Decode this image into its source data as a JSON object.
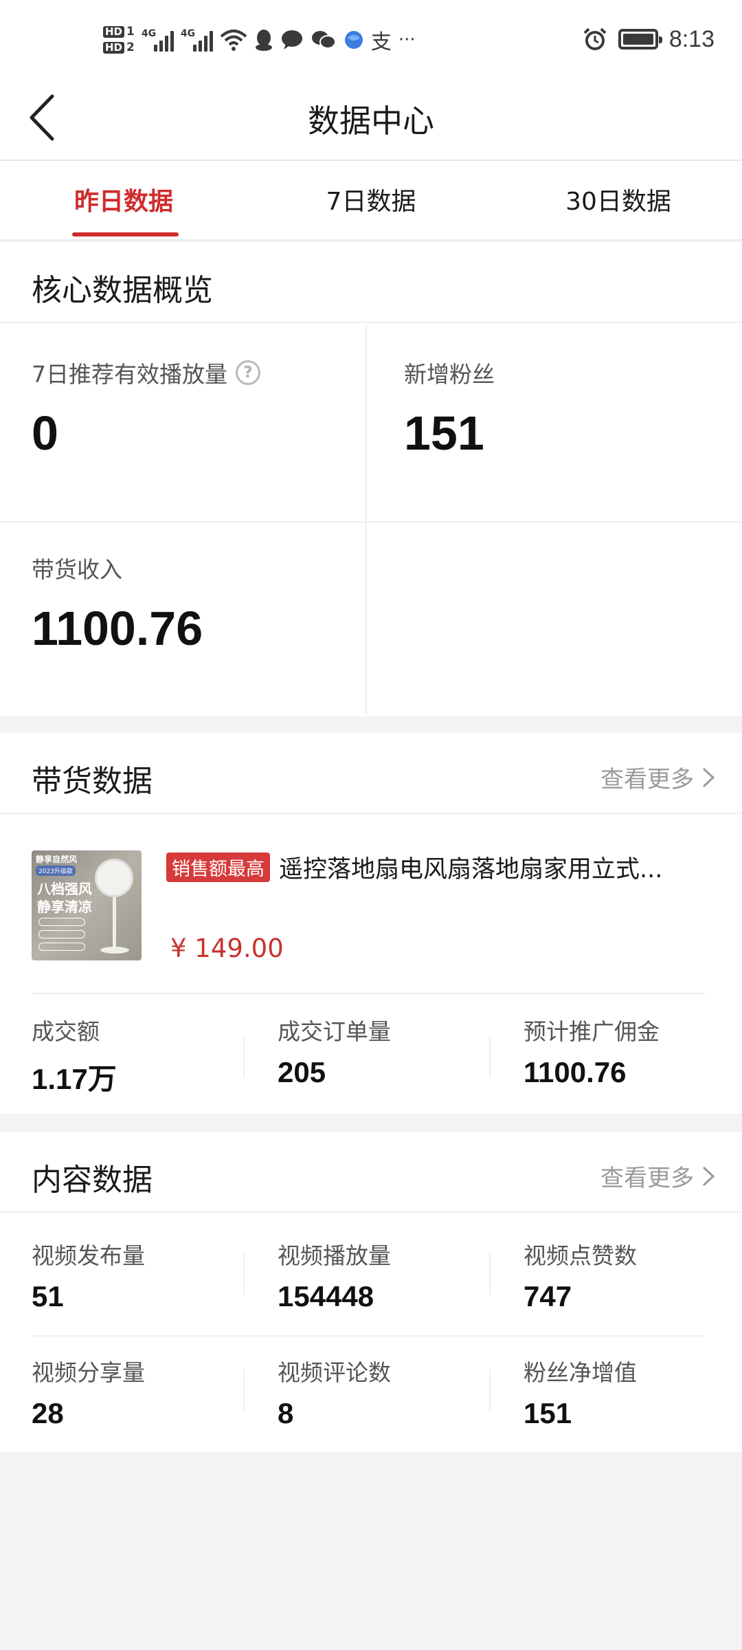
{
  "status_bar": {
    "time": "8:13",
    "sim1": "HD",
    "sim1_num": "1",
    "sim2": "HD",
    "sim2_num": "2",
    "net1": "4G",
    "net2": "4G",
    "alipay": "支",
    "more": "···",
    "icons": [
      "sim-hd-icon",
      "signal-icon",
      "wifi-icon",
      "qq-icon",
      "message-icon",
      "wechat-icon",
      "browser-icon",
      "alipay-icon",
      "alarm-icon",
      "battery-icon"
    ]
  },
  "header": {
    "title": "数据中心"
  },
  "tabs": [
    {
      "label": "昨日数据",
      "active": true
    },
    {
      "label": "7日数据",
      "active": false
    },
    {
      "label": "30日数据",
      "active": false
    }
  ],
  "core": {
    "title": "核心数据概览",
    "items": [
      {
        "label": "7日推荐有效播放量",
        "value": "0",
        "help": "?"
      },
      {
        "label": "新增粉丝",
        "value": "151"
      },
      {
        "label": "带货收入",
        "value": "1100.76"
      }
    ]
  },
  "sales": {
    "title": "带货数据",
    "more": "查看更多",
    "product": {
      "badge": "销售额最高",
      "name": "遥控落地扇电风扇落地扇家用立式...",
      "price": "¥ 149.00",
      "img_brand": "静享自然风",
      "img_tag": "2023升级款",
      "img_line1": "八档强风",
      "img_line2": "静享清凉"
    },
    "stats": [
      {
        "label": "成交额",
        "value": "1.17万"
      },
      {
        "label": "成交订单量",
        "value": "205"
      },
      {
        "label": "预计推广佣金",
        "value": "1100.76"
      }
    ]
  },
  "content": {
    "title": "内容数据",
    "more": "查看更多",
    "stats": [
      {
        "label": "视频发布量",
        "value": "51"
      },
      {
        "label": "视频播放量",
        "value": "154448"
      },
      {
        "label": "视频点赞数",
        "value": "747"
      },
      {
        "label": "视频分享量",
        "value": "28"
      },
      {
        "label": "视频评论数",
        "value": "8"
      },
      {
        "label": "粉丝净增值",
        "value": "151"
      }
    ]
  },
  "colors": {
    "accent": "#cf2c2c",
    "price": "#c8322d",
    "badge": "#d63a3a",
    "muted": "#9a9a9a"
  }
}
